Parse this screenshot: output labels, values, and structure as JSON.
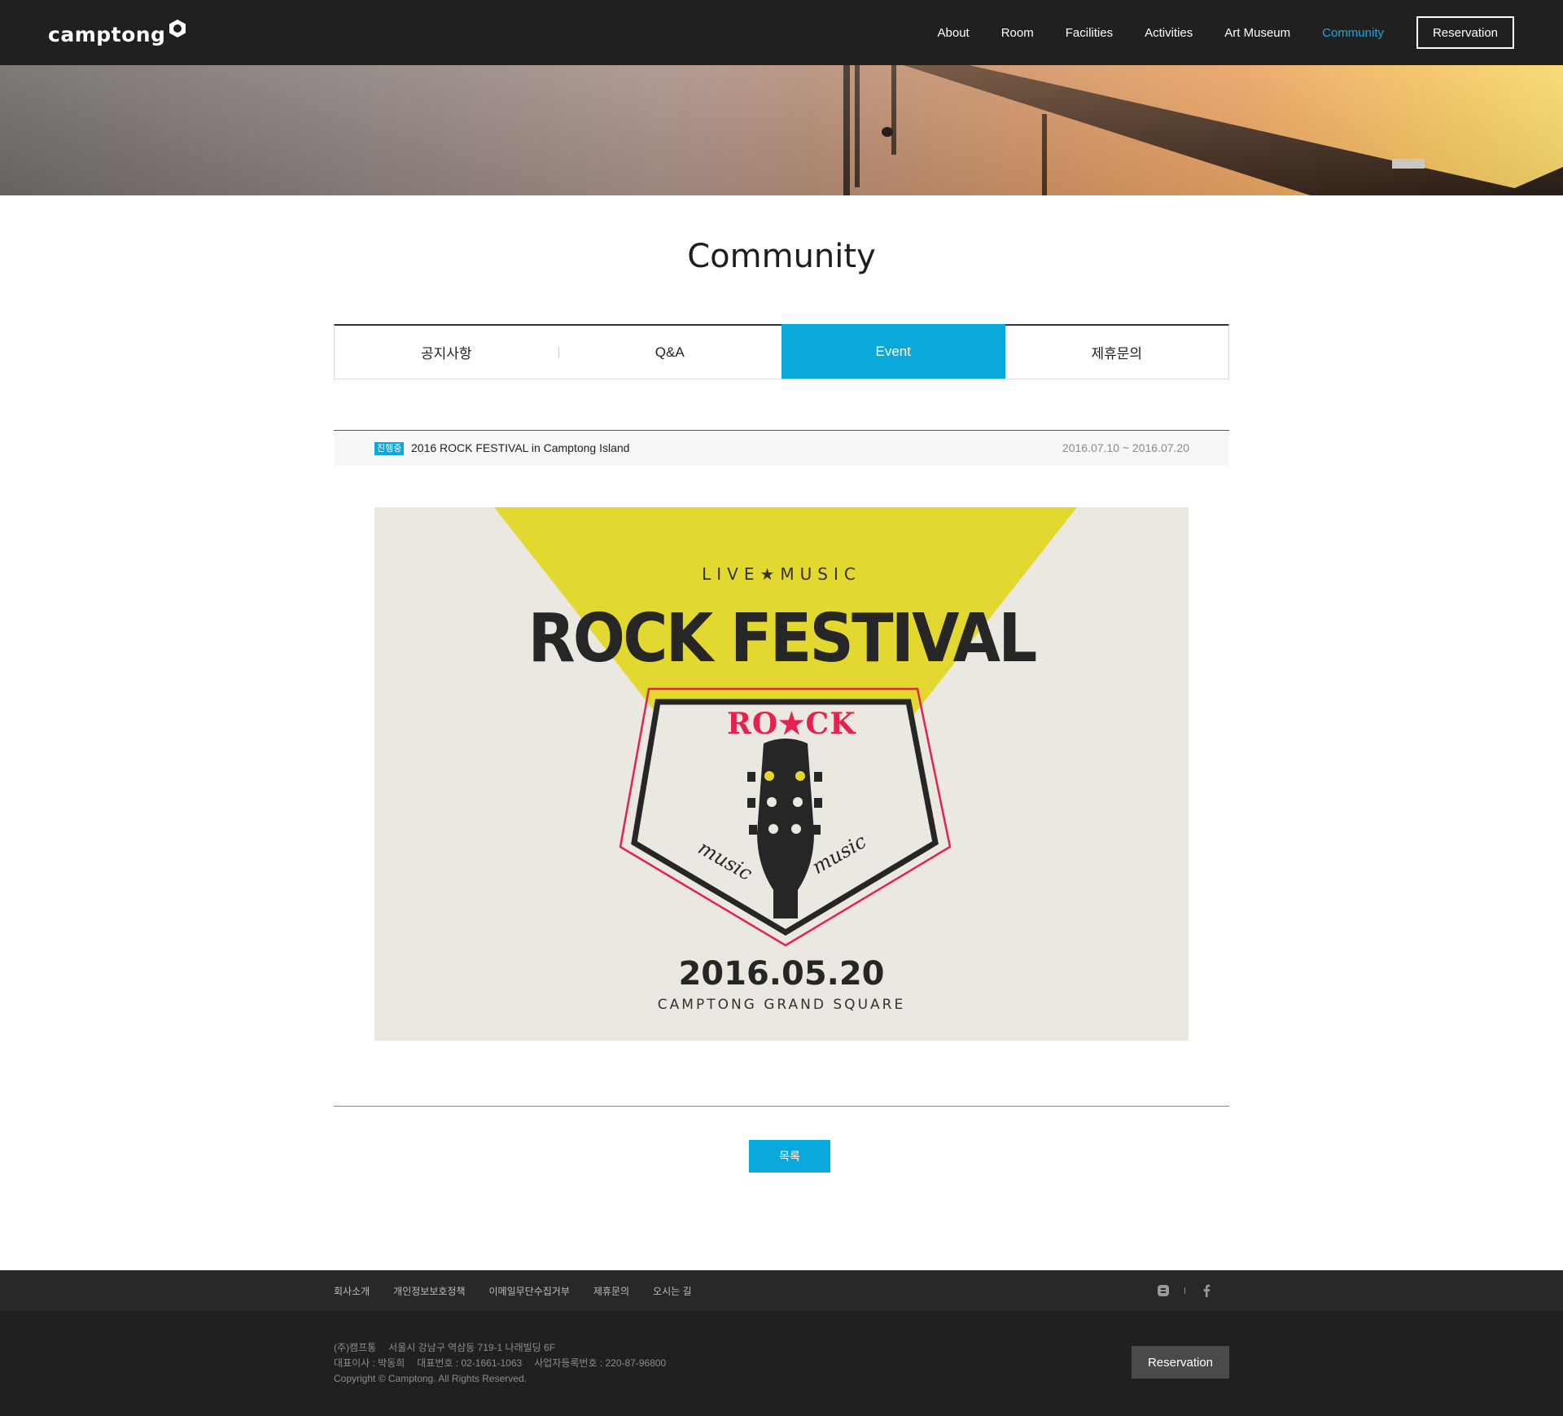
{
  "header": {
    "logo_text": "camptong",
    "nav": [
      "About",
      "Room",
      "Facilities",
      "Activities",
      "Art Museum",
      "Community"
    ],
    "active_nav": "Community",
    "reservation_label": "Reservation"
  },
  "page": {
    "title": "Community"
  },
  "tabs": [
    {
      "label": "공지사항",
      "active": false
    },
    {
      "label": "Q&A",
      "active": false
    },
    {
      "label": "Event",
      "active": true
    },
    {
      "label": "제휴문의",
      "active": false
    }
  ],
  "post": {
    "badge": "진행중",
    "title": "2016 ROCK FESTIVAL in Camptong Island",
    "date_range": "2016.07.10 ~ 2016.07.20"
  },
  "poster": {
    "kicker": "LIVE★MUSIC",
    "headline": "ROCK FESTIVAL",
    "badge_text": "RO★CK",
    "music_left": "music",
    "music_right": "music",
    "date": "2016.05.20",
    "venue": "CAMPTONG GRAND SQUARE"
  },
  "buttons": {
    "list_label": "목록"
  },
  "footer": {
    "links": [
      "회사소개",
      "개인정보보호정책",
      "이메일무단수집거부",
      "제휴문의",
      "오시는 길"
    ],
    "social": [
      "blog-icon",
      "facebook-icon"
    ],
    "company": "(주)캠프통",
    "address": "서울시 강남구 역삼동 719-1 나래빌딩 6F",
    "ceo": "대표이사 : 박동희",
    "phone": "대표번호 : 02-1661-1063",
    "biz_no": "사업자등록번호 : 220-87-96800",
    "copyright": "Copyright © Camptong. All Rights Reserved.",
    "reservation_label": "Reservation"
  },
  "colors": {
    "accent": "#0aa9dc",
    "header_bg": "#202020",
    "poster_yellow": "#e2d82f",
    "poster_red": "#e5214f"
  }
}
